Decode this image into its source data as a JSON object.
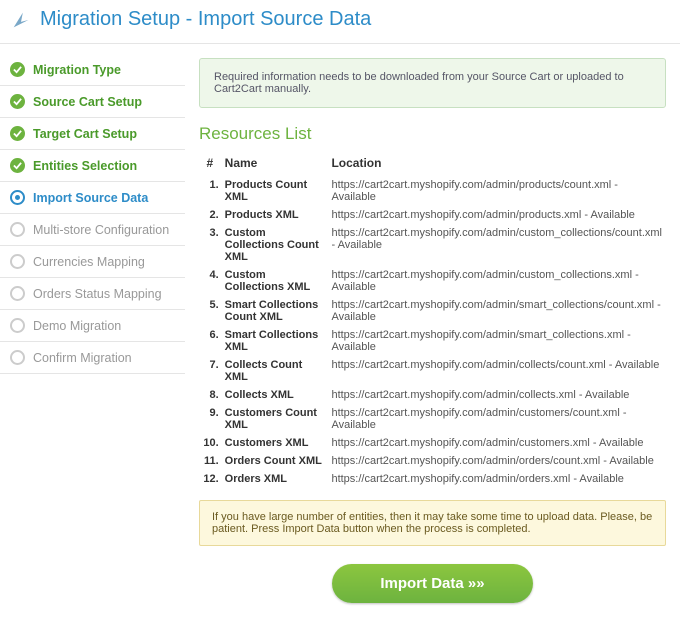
{
  "header": {
    "title": "Migration Setup - Import Source Data"
  },
  "infoBox": "Required information needs to be downloaded from your Source Cart or uploaded to Cart2Cart manually.",
  "sectionTitle": "Resources List",
  "tableHeaders": {
    "num": "#",
    "name": "Name",
    "location": "Location"
  },
  "warnBox": "If you have large number of entities, then it may take some time to upload data. Please, be patient. Press Import Data button when the process is completed.",
  "button": "Import Data »»",
  "steps": [
    {
      "label": "Migration Type",
      "state": "done"
    },
    {
      "label": "Source Cart Setup",
      "state": "done"
    },
    {
      "label": "Target Cart Setup",
      "state": "done"
    },
    {
      "label": "Entities Selection",
      "state": "done"
    },
    {
      "label": "Import Source Data",
      "state": "active"
    },
    {
      "label": "Multi-store Configuration",
      "state": "pending"
    },
    {
      "label": "Currencies Mapping",
      "state": "pending"
    },
    {
      "label": "Orders Status Mapping",
      "state": "pending"
    },
    {
      "label": "Demo Migration",
      "state": "pending"
    },
    {
      "label": "Confirm Migration",
      "state": "pending"
    }
  ],
  "resources": [
    {
      "n": "1.",
      "name": "Products Count XML",
      "loc": "https://cart2cart.myshopify.com/admin/products/count.xml - Available"
    },
    {
      "n": "2.",
      "name": "Products XML",
      "loc": "https://cart2cart.myshopify.com/admin/products.xml - Available"
    },
    {
      "n": "3.",
      "name": "Custom Collections Count XML",
      "loc": "https://cart2cart.myshopify.com/admin/custom_collections/count.xml - Available"
    },
    {
      "n": "4.",
      "name": "Custom Collections XML",
      "loc": "https://cart2cart.myshopify.com/admin/custom_collections.xml - Available"
    },
    {
      "n": "5.",
      "name": "Smart Collections Count XML",
      "loc": "https://cart2cart.myshopify.com/admin/smart_collections/count.xml - Available"
    },
    {
      "n": "6.",
      "name": "Smart Collections XML",
      "loc": "https://cart2cart.myshopify.com/admin/smart_collections.xml - Available"
    },
    {
      "n": "7.",
      "name": "Collects Count XML",
      "loc": "https://cart2cart.myshopify.com/admin/collects/count.xml - Available"
    },
    {
      "n": "8.",
      "name": "Collects XML",
      "loc": "https://cart2cart.myshopify.com/admin/collects.xml - Available"
    },
    {
      "n": "9.",
      "name": "Customers Count XML",
      "loc": "https://cart2cart.myshopify.com/admin/customers/count.xml - Available"
    },
    {
      "n": "10.",
      "name": "Customers XML",
      "loc": "https://cart2cart.myshopify.com/admin/customers.xml - Available"
    },
    {
      "n": "11.",
      "name": "Orders Count XML",
      "loc": "https://cart2cart.myshopify.com/admin/orders/count.xml - Available"
    },
    {
      "n": "12.",
      "name": "Orders XML",
      "loc": "https://cart2cart.myshopify.com/admin/orders.xml - Available"
    }
  ]
}
